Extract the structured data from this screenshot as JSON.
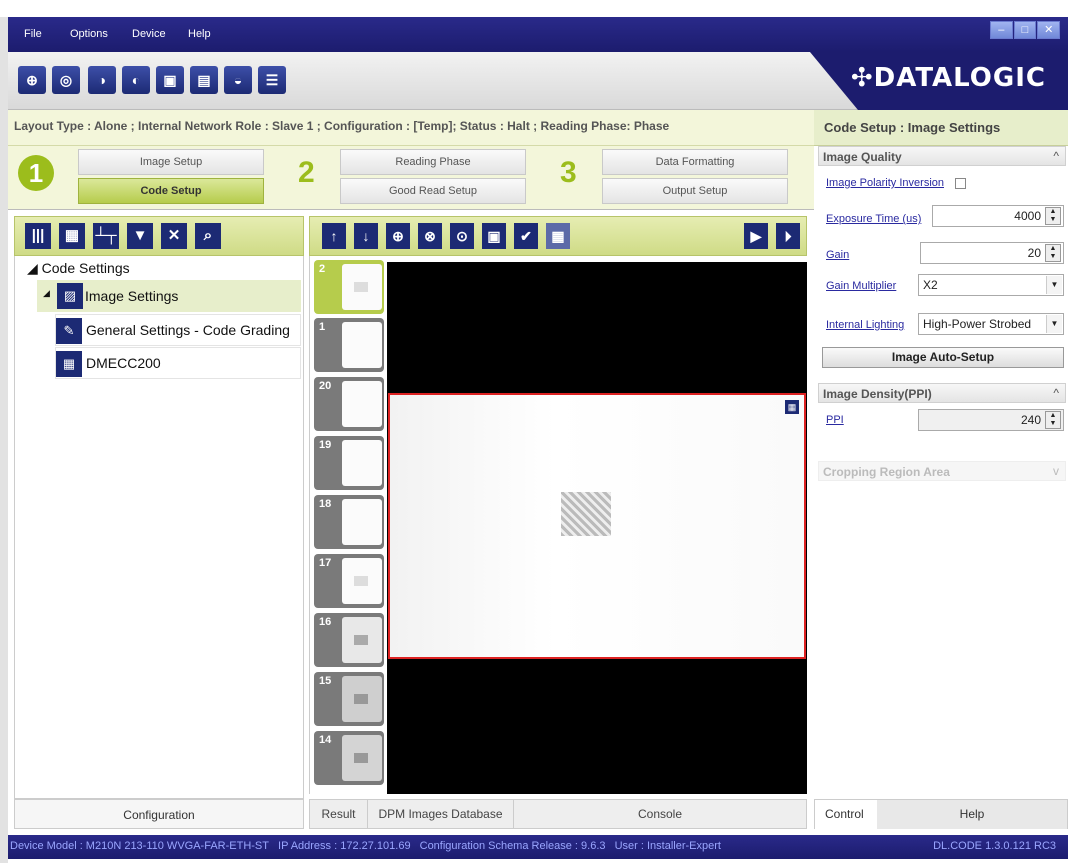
{
  "menu": [
    "File",
    "Options",
    "Device",
    "Help"
  ],
  "brand": "✣DATALOGIC",
  "status_line": "Layout Type : Alone ; Internal Network Role : Slave 1 ; Configuration : [Temp]; Status : Halt ; Reading Phase: Phase",
  "steps": {
    "n1": "1",
    "n2": "2",
    "n3": "3",
    "image_setup": "Image Setup",
    "code_setup": "Code Setup",
    "reading_phase": "Reading Phase",
    "good_read_setup": "Good Read Setup",
    "data_formatting": "Data Formatting",
    "output_setup": "Output Setup"
  },
  "tree": {
    "root": "Code Settings",
    "image_settings": "Image Settings",
    "general_settings": "General Settings - Code Grading",
    "dmecc": "DMECC200"
  },
  "left_footer": "Configuration",
  "thumbnails": [
    "2",
    "1",
    "20",
    "19",
    "18",
    "17",
    "16",
    "15",
    "14"
  ],
  "view_tabs": {
    "result": "Result",
    "dpm": "DPM Images Database",
    "console": "Console"
  },
  "right": {
    "title": "Code Setup : Image Settings",
    "image_quality": "Image Quality",
    "polarity": "Image Polarity Inversion",
    "exposure_label": "Exposure Time (us)",
    "exposure_value": "4000",
    "gain_label": "Gain",
    "gain_value": "20",
    "gain_mult_label": "Gain Multiplier",
    "gain_mult_value": "X2",
    "lighting_label": "Internal Lighting",
    "lighting_value": "High-Power Strobed",
    "auto_setup": "Image Auto-Setup",
    "density": "Image Density(PPI)",
    "ppi_label": "PPI",
    "ppi_value": "240",
    "cropping": "Cropping Region Area",
    "tab_control": "Control",
    "tab_help": "Help"
  },
  "statusbar": {
    "model": "Device Model : M210N 213-110 WVGA-FAR-ETH-ST",
    "ip": "IP Address : 172.27.101.69",
    "schema": "Configuration Schema Release : 9.6.3",
    "user": "User : Installer-Expert",
    "version": "DL.CODE 1.3.0.121 RC3"
  }
}
